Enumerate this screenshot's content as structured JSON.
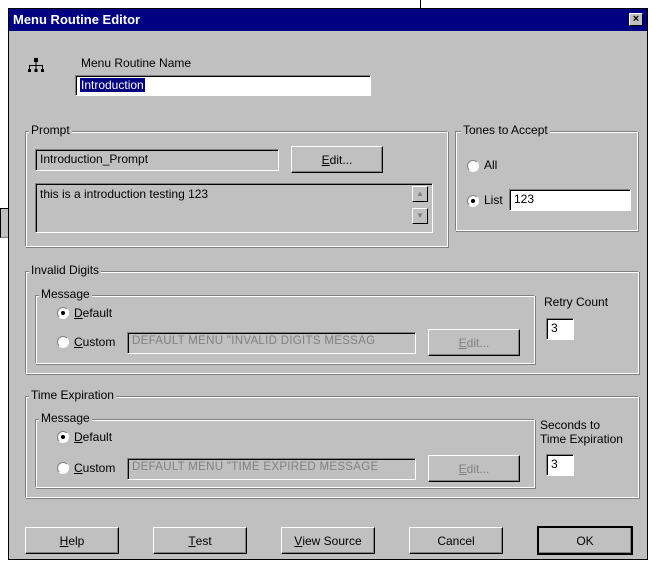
{
  "window": {
    "title": "Menu Routine Editor",
    "close_glyph": "×"
  },
  "routine": {
    "icon": "hierarchy-icon",
    "label": "Menu Routine Name",
    "value": "Introduction"
  },
  "prompt": {
    "legend": "Prompt",
    "name_value": "Introduction_Prompt",
    "edit_prefix": "E",
    "edit_rest": "dit...",
    "text_value": "this is a introduction  testing 123"
  },
  "tones": {
    "legend": "Tones to Accept",
    "all_label": "All",
    "list_label": "List",
    "list_value": "123",
    "selected": "list"
  },
  "invalid": {
    "legend": "Invalid Digits",
    "message_legend": "Message",
    "default_prefix": "D",
    "default_rest": "efault",
    "custom_prefix": "C",
    "custom_rest": "ustom",
    "custom_value": "DEFAULT MENU \"INVALID DIGITS MESSAG",
    "edit_prefix": "E",
    "edit_rest": "dit...",
    "retry_label": "Retry Count",
    "retry_value": "3",
    "selected": "default"
  },
  "timeexp": {
    "legend": "Time Expiration",
    "message_legend": "Message",
    "default_prefix": "D",
    "default_rest": "efault",
    "custom_prefix": "C",
    "custom_rest": "ustom",
    "custom_value": "DEFAULT MENU \"TIME EXPIRED MESSAGE",
    "edit_prefix": "E",
    "edit_rest": "dit...",
    "seconds_label_1": "Seconds to",
    "seconds_label_2": "Time Expiration",
    "seconds_value": "3",
    "selected": "default"
  },
  "buttons": {
    "help_prefix": "H",
    "help_rest": "elp",
    "test_prefix": "T",
    "test_rest": "est",
    "view_prefix": "V",
    "view_rest": "iew Source",
    "cancel": "Cancel",
    "ok": "OK"
  },
  "colors": {
    "titlebar": "#000080",
    "face": "#c0c0c0",
    "selection": "#000080"
  }
}
